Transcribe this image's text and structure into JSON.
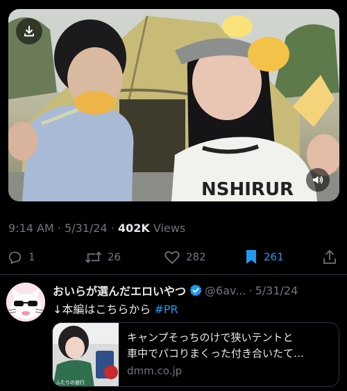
{
  "video": {
    "download_icon": "download-icon",
    "volume_icon": "volume-icon",
    "shirt_text": "NSHIRUR"
  },
  "tweet_meta": {
    "time": "9:14 AM",
    "separator": "·",
    "date": "5/31/24",
    "views_count": "402K",
    "views_label": "Views"
  },
  "actions": {
    "reply": {
      "icon": "reply-icon",
      "count": "1"
    },
    "retweet": {
      "icon": "retweet-icon",
      "count": "26"
    },
    "like": {
      "icon": "heart-icon",
      "count": "282"
    },
    "bookmark": {
      "icon": "bookmark-icon",
      "count": "261",
      "active": true
    },
    "share": {
      "icon": "share-icon"
    }
  },
  "colors": {
    "background": "#000000",
    "text_primary": "#e7e9ea",
    "text_secondary": "#71767b",
    "accent": "#1d9bf0",
    "divider": "#2f3336"
  },
  "reply_post": {
    "display_name": "おいらが選んだエロいやつ",
    "verified_icon": "verified-badge-icon",
    "handle": "@6av...",
    "separator": "·",
    "date": "5/31/24",
    "text_prefix": "↓本編はこちらから ",
    "hashtag": "#PR",
    "link_card": {
      "title_line1": "キャンプそっちのけで狭いテントと",
      "title_line2": "車中でパコりまくった付き合いたて…",
      "domain": "dmm.co.jp",
      "thumb_text": "ふたりの旅行"
    }
  }
}
